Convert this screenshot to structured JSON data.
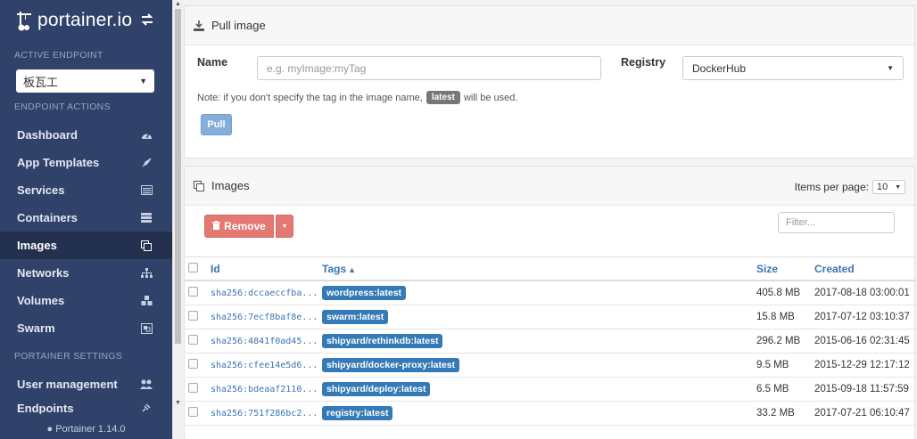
{
  "sidebar": {
    "brand": "portainer.io",
    "active_endpoint_label": "ACTIVE ENDPOINT",
    "endpoint_selected": "板瓦工",
    "endpoint_actions_label": "ENDPOINT ACTIONS",
    "items": [
      {
        "label": "Dashboard",
        "icon": "dashboard-icon"
      },
      {
        "label": "App Templates",
        "icon": "rocket-icon"
      },
      {
        "label": "Services",
        "icon": "list-alt-icon"
      },
      {
        "label": "Containers",
        "icon": "server-icon"
      },
      {
        "label": "Images",
        "icon": "clone-icon",
        "active": true
      },
      {
        "label": "Networks",
        "icon": "sitemap-icon"
      },
      {
        "label": "Volumes",
        "icon": "cubes-icon"
      },
      {
        "label": "Swarm",
        "icon": "object-group-icon"
      }
    ],
    "settings_label": "PORTAINER SETTINGS",
    "settings_items": [
      {
        "label": "User management",
        "icon": "users-icon"
      },
      {
        "label": "Endpoints",
        "icon": "plug-icon"
      }
    ],
    "footer": "Portainer 1.14.0"
  },
  "pull": {
    "title": "Pull image",
    "name_label": "Name",
    "name_placeholder": "e.g. myImage:myTag",
    "registry_label": "Registry",
    "registry_value": "DockerHub",
    "note_before": "Note: if you don't specify the tag in the image name,",
    "note_tag": "latest",
    "note_after": "will be used.",
    "pull_button": "Pull"
  },
  "images": {
    "title": "Images",
    "items_per_page_label": "Items per page:",
    "items_per_page_value": "10",
    "remove_button": "Remove",
    "filter_placeholder": "Filter...",
    "columns": {
      "id": "Id",
      "tags": "Tags",
      "size": "Size",
      "created": "Created"
    },
    "rows": [
      {
        "id": "sha256:dccaeccfba...",
        "tag": "wordpress:latest",
        "size": "405.8 MB",
        "created": "2017-08-18 03:00:01"
      },
      {
        "id": "sha256:7ecf8baf8e...",
        "tag": "swarm:latest",
        "size": "15.8 MB",
        "created": "2017-07-12 03:10:37"
      },
      {
        "id": "sha256:4841f0ad45...",
        "tag": "shipyard/rethinkdb:latest",
        "size": "296.2 MB",
        "created": "2015-06-16 02:31:45"
      },
      {
        "id": "sha256:cfee14e5d6...",
        "tag": "shipyard/docker-proxy:latest",
        "size": "9.5 MB",
        "created": "2015-12-29 12:17:12"
      },
      {
        "id": "sha256:bdeaaf2110...",
        "tag": "shipyard/deploy:latest",
        "size": "6.5 MB",
        "created": "2015-09-18 11:57:59"
      },
      {
        "id": "sha256:751f286bc2...",
        "tag": "registry:latest",
        "size": "33.2 MB",
        "created": "2017-07-21 06:10:47"
      }
    ]
  },
  "colors": {
    "sidebar_bg": "#30426a",
    "link_blue": "#3a75b0",
    "tag_blue": "#337ab7",
    "danger": "#e47873",
    "pull_btn": "#85aedb"
  }
}
